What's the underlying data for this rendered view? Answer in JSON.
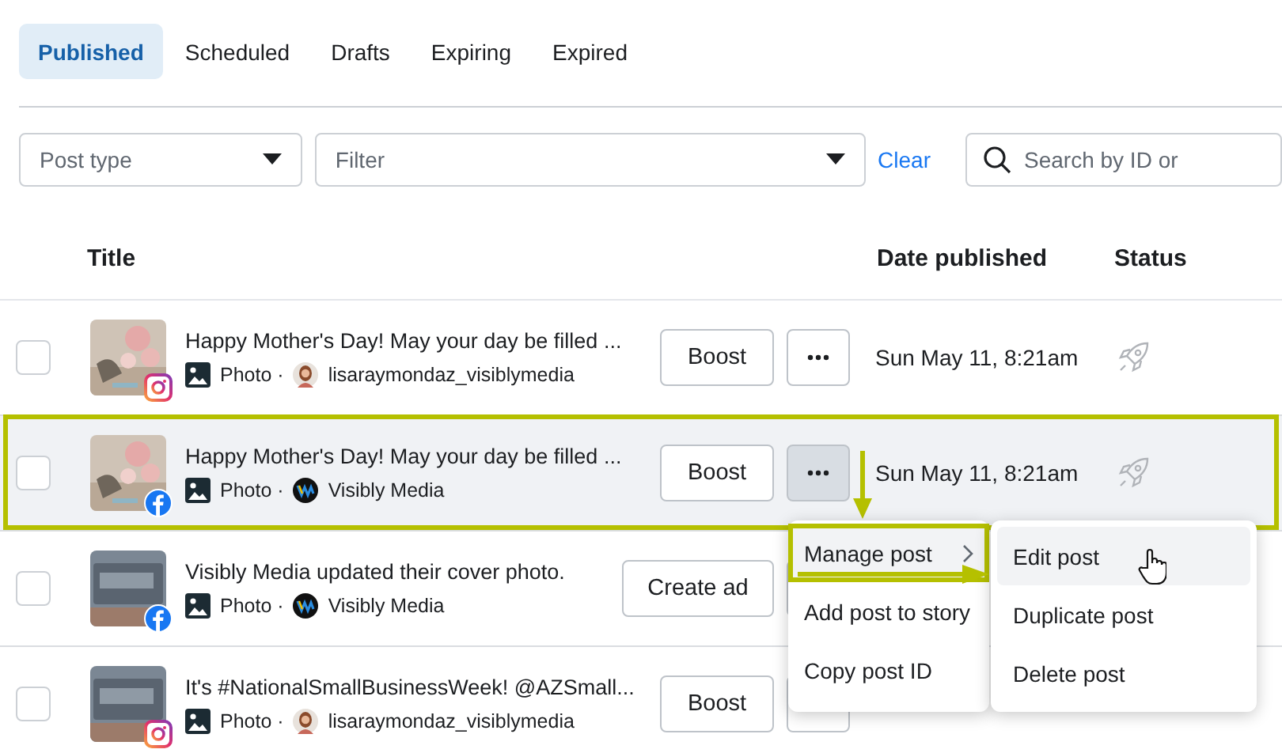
{
  "tabs": [
    {
      "label": "Published",
      "selected": true
    },
    {
      "label": "Scheduled",
      "selected": false
    },
    {
      "label": "Drafts",
      "selected": false
    },
    {
      "label": "Expiring",
      "selected": false
    },
    {
      "label": "Expired",
      "selected": false
    }
  ],
  "filters": {
    "post_type": {
      "placeholder": "Post type"
    },
    "filter": {
      "placeholder": "Filter"
    },
    "clear": "Clear",
    "search": {
      "placeholder": "Search by ID or"
    }
  },
  "table": {
    "columns": [
      "Title",
      "Date published",
      "Status"
    ],
    "rows": [
      {
        "checked": false,
        "thumbnail": {
          "kind": "flowers"
        },
        "platform_badge": {
          "kind": "instagram"
        },
        "title": "Happy Mother's Day! May your day be filled ...",
        "type": "Photo",
        "separator": "·",
        "avatar": {
          "kind": "person"
        },
        "account": "lisaraymondaz_visiblymedia",
        "action": "Boost",
        "date": "Sun May 11, 8:21am",
        "highlighted": false,
        "menu_open": false
      },
      {
        "checked": false,
        "thumbnail": {
          "kind": "flowers"
        },
        "platform_badge": {
          "kind": "facebook"
        },
        "title": "Happy Mother's Day! May your day be filled ...",
        "type": "Photo",
        "separator": "·",
        "avatar": {
          "kind": "logo"
        },
        "account": "Visibly Media",
        "action": "Boost",
        "date": "Sun May 11, 8:21am",
        "highlighted": true,
        "menu_open": true
      },
      {
        "checked": false,
        "thumbnail": {
          "kind": "sign"
        },
        "platform_badge": {
          "kind": "facebook"
        },
        "title": "Visibly Media updated their cover photo.",
        "type": "Photo",
        "separator": "·",
        "avatar": {
          "kind": "logo"
        },
        "account": "Visibly Media",
        "action": "Create ad",
        "highlighted": false,
        "menu_open": false
      },
      {
        "checked": false,
        "thumbnail": {
          "kind": "sign"
        },
        "platform_badge": {
          "kind": "instagram"
        },
        "title": "It's #NationalSmallBusinessWeek! @AZSmall...",
        "type": "Photo",
        "separator": "·",
        "avatar": {
          "kind": "person"
        },
        "account": "lisaraymondaz_visiblymedia",
        "action": "Boost",
        "highlighted": false,
        "menu_open": false
      }
    ]
  },
  "menu": {
    "items": [
      {
        "label": "Manage post",
        "submenu": true,
        "selected": true
      },
      {
        "label": "Add post to story",
        "submenu": false,
        "selected": false
      },
      {
        "label": "Copy post ID",
        "submenu": false,
        "selected": false
      }
    ],
    "submenu": [
      {
        "label": "Edit post",
        "hovered": true
      },
      {
        "label": "Duplicate post",
        "hovered": false
      },
      {
        "label": "Delete post",
        "hovered": false
      }
    ]
  }
}
